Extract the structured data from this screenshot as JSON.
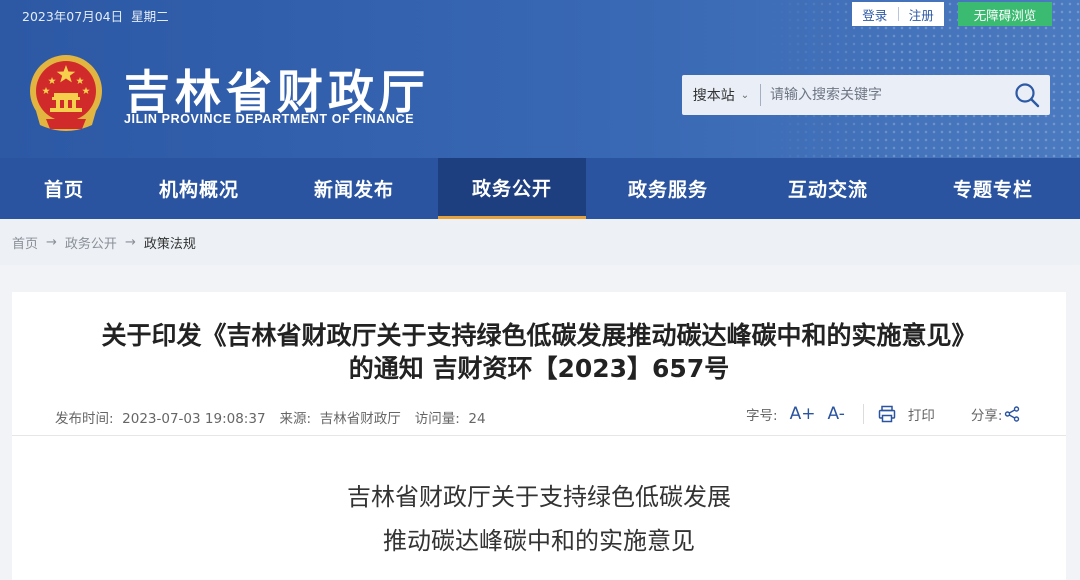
{
  "topbar": {
    "date": "2023年07月04日",
    "weekday": "星期二",
    "login": "登录",
    "register": "注册",
    "accessible": "无障碍浏览"
  },
  "site": {
    "title": "吉林省财政厅",
    "subtitle": "JILIN PROVINCE DEPARTMENT OF FINANCE"
  },
  "search": {
    "scope": "搜本站",
    "placeholder": "请输入搜索关键字"
  },
  "nav": {
    "items": [
      {
        "label": "首页"
      },
      {
        "label": "机构概况"
      },
      {
        "label": "新闻发布"
      },
      {
        "label": "政务公开"
      },
      {
        "label": "政务服务"
      },
      {
        "label": "互动交流"
      },
      {
        "label": "专题专栏"
      }
    ],
    "active_index": 3
  },
  "breadcrumb": [
    "首页",
    "政务公开",
    "政策法规"
  ],
  "article": {
    "title_line1": "关于印发《吉林省财政厅关于支持绿色低碳发展推动碳达峰碳中和的实施意见》",
    "title_line2": "的通知 吉财资环【2023】657号",
    "publish_label": "发布时间:",
    "publish_time": "2023-07-03 19:08:37",
    "source_label": "来源:",
    "source": "吉林省财政厅",
    "views_label": "访问量:",
    "views": "24",
    "font_size_label": "字号:",
    "font_up": "A+",
    "font_down": "A-",
    "print_label": "打印",
    "share_label": "分享:",
    "body_title_line1": "吉林省财政厅关于支持绿色低碳发展",
    "body_title_line2": "推动碳达峰碳中和的实施意见"
  },
  "colors": {
    "header_blue": "#2c58a4",
    "nav_blue": "#2a54a0",
    "nav_active": "#1d3f80",
    "accessible_green": "#3bbb72"
  }
}
